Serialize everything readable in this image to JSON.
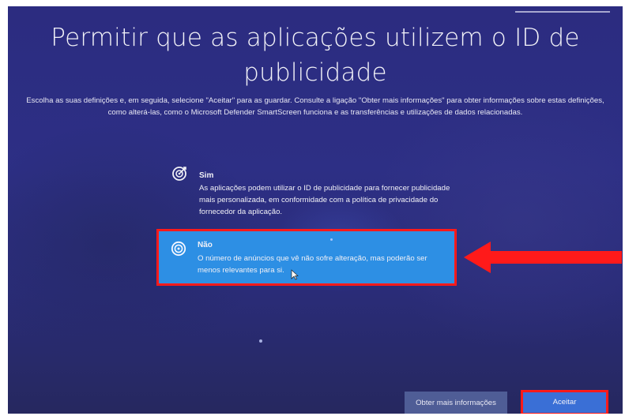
{
  "dialog": {
    "title": "Permitir que as aplicações utilizem o ID de publicidade",
    "description": "Escolha as suas definições e, em seguida, selecione \"Aceitar\" para as guardar. Consulte a ligação \"Obter mais informações\" para obter informações sobre estas definições, como alterá-las, como o Microsoft Defender SmartScreen funciona e as transferências e utilizações de dados relacionadas."
  },
  "options": [
    {
      "label": "Sim",
      "text": "As aplicações podem utilizar o ID de publicidade para fornecer publicidade mais personalizada, em conformidade com a política de privacidade do fornecedor da aplicação.",
      "icon": "target-check-icon",
      "selected": false
    },
    {
      "label": "Não",
      "text": "O número de anúncios que vê não sofre alteração, mas poderão ser menos relevantes para si.",
      "icon": "target-icon",
      "selected": true
    }
  ],
  "buttons": {
    "more_info": "Obter mais informações",
    "accept": "Aceitar"
  },
  "colors": {
    "background": "#2c2c80",
    "selected_option": "#2d8fe4",
    "accept_button": "#3a6fd6",
    "more_info_button": "#4f5d96",
    "annotation": "#ff1a1a"
  },
  "annotations": {
    "arrow_icon": "red-arrow-left-icon",
    "highlight": "red-outline"
  }
}
